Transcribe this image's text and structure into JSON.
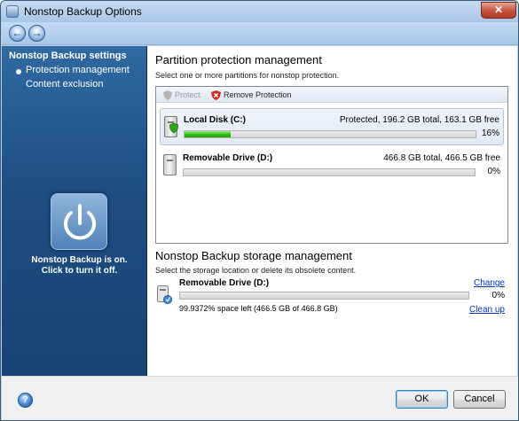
{
  "window": {
    "title": "Nonstop Backup Options",
    "close_glyph": "✕"
  },
  "nav": {
    "back_glyph": "←",
    "forward_glyph": "→"
  },
  "sidebar": {
    "title": "Nonstop Backup settings",
    "items": [
      {
        "label": "Protection management",
        "selected": true
      },
      {
        "label": "Content exclusion",
        "selected": false
      }
    ],
    "status_line1": "Nonstop Backup is on.",
    "status_line2": "Click to turn it off."
  },
  "partition": {
    "title": "Partition protection management",
    "desc": "Select one or more partitions for nonstop protection.",
    "toolbar": {
      "protect": "Protect",
      "remove": "Remove Protection"
    },
    "drives": [
      {
        "name": "Local Disk (C:)",
        "stats": "Protected, 196.2 GB total, 163.1 GB free",
        "percent_label": "16%",
        "fill_fraction": 0.16,
        "protected": true,
        "selected": true
      },
      {
        "name": "Removable Drive (D:)",
        "stats": "466.8 GB total, 466.5 GB free",
        "percent_label": "0%",
        "fill_fraction": 0.0,
        "protected": false,
        "selected": false
      }
    ]
  },
  "storage": {
    "title": "Nonstop Backup storage management",
    "desc": "Select the storage location or delete its obsolete content.",
    "drive_name": "Removable Drive (D:)",
    "percent_label": "0%",
    "fill_fraction": 0.0,
    "space": "99.9372% space left (466.5 GB of 466.8 GB)",
    "change_link": "Change",
    "cleanup_link": "Clean up"
  },
  "footer": {
    "help_glyph": "?",
    "ok": "OK",
    "cancel": "Cancel"
  },
  "colors": {
    "sidebar_bg": "#1d4d81",
    "progress_green": "#2fbf1a",
    "link": "#0033cc"
  }
}
